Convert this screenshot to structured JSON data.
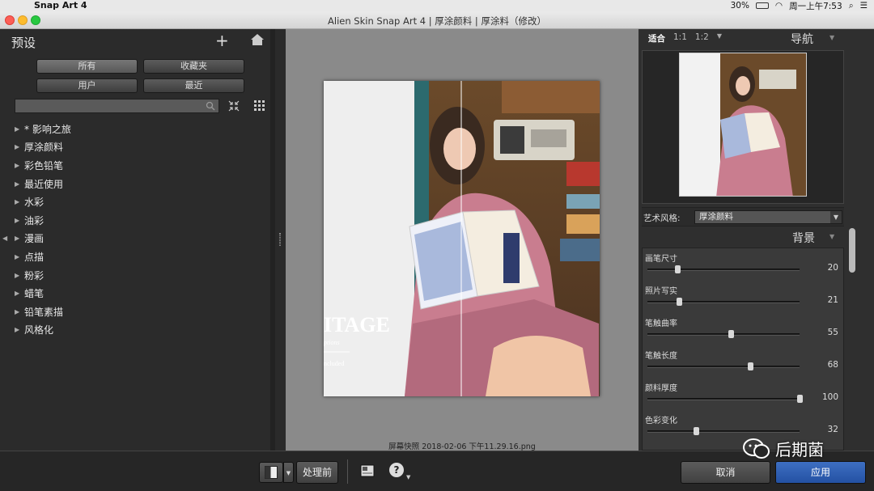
{
  "menubar": {
    "app_name": "Snap Art 4",
    "battery": "30%",
    "clock": "周一上午7:53"
  },
  "window": {
    "title": "Alien Skin Snap Art 4 | 厚涂颜料 | 厚涂料（修改）"
  },
  "presets": {
    "title": "预设",
    "filters": [
      "所有",
      "收藏夹",
      "用户",
      "最近"
    ],
    "search_placeholder": "",
    "categories": [
      "* 影响之旅",
      "厚涂颜料",
      "彩色铅笔",
      "最近使用",
      "水彩",
      "油彩",
      "漫画",
      "点描",
      "粉彩",
      "蜡笔",
      "铅笔素描",
      "风格化"
    ]
  },
  "preview": {
    "filename": "屏幕快照 2018-02-06 下午11.29.16.png",
    "photo_text": {
      "big": "ITAGE",
      "small": "ptions",
      "small2": "ncluded"
    }
  },
  "navigator": {
    "zoom_options": [
      "适合",
      "1:1",
      "1:2"
    ],
    "title": "导航"
  },
  "art_style": {
    "label": "艺术风格:",
    "value": "厚涂颜料"
  },
  "background": {
    "title": "背景",
    "params": [
      {
        "label": "画笔尺寸",
        "value": "20",
        "level": 0.2
      },
      {
        "label": "照片写实",
        "value": "21",
        "level": 0.21
      },
      {
        "label": "笔触曲率",
        "value": "55",
        "level": 0.55
      },
      {
        "label": "笔触长度",
        "value": "68",
        "level": 0.68
      },
      {
        "label": "颜料厚度",
        "value": "100",
        "level": 1.0
      },
      {
        "label": "色彩变化",
        "value": "32",
        "level": 0.32
      }
    ]
  },
  "bottom": {
    "before_label": "处理前",
    "cancel_label": "取消",
    "apply_label": "应用"
  },
  "watermark": {
    "text": "后期菌"
  }
}
